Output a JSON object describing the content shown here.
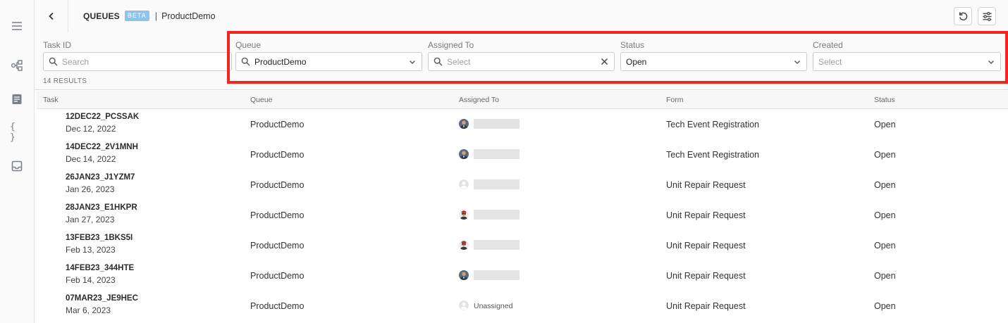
{
  "header": {
    "title": "QUEUES",
    "badge": "BETA",
    "separator": "|",
    "current": "ProductDemo"
  },
  "sidebar": {
    "icons": [
      "menu-icon",
      "workflow-icon",
      "document-icon",
      "code-braces-icon",
      "inbox-icon"
    ]
  },
  "filters": {
    "task_id": {
      "label": "Task ID",
      "placeholder": "Search"
    },
    "queue": {
      "label": "Queue",
      "value": "ProductDemo"
    },
    "assigned_to": {
      "label": "Assigned To",
      "placeholder": "Select"
    },
    "status": {
      "label": "Status",
      "value": "Open"
    },
    "created": {
      "label": "Created",
      "placeholder": "Select"
    }
  },
  "results_count": "14 RESULTS",
  "table": {
    "columns": [
      "Task",
      "Queue",
      "Assigned To",
      "Form",
      "Status"
    ],
    "rows": [
      {
        "id": "12DEC22_PCSSAK",
        "date": "Dec 12, 2022",
        "queue": "ProductDemo",
        "avatar": "person-a",
        "assigned": "",
        "form": "Tech Event Registration",
        "status": "Open"
      },
      {
        "id": "14DEC22_2V1MNH",
        "date": "Dec 14, 2022",
        "queue": "ProductDemo",
        "avatar": "person-a",
        "assigned": "",
        "form": "Tech Event Registration",
        "status": "Open"
      },
      {
        "id": "26JAN23_J1YZM7",
        "date": "Jan 26, 2023",
        "queue": "ProductDemo",
        "avatar": "default",
        "assigned": "",
        "form": "Unit Repair Request",
        "status": "Open"
      },
      {
        "id": "28JAN23_E1HKPR",
        "date": "Jan 27, 2023",
        "queue": "ProductDemo",
        "avatar": "person-b",
        "assigned": "",
        "form": "Unit Repair Request",
        "status": "Open"
      },
      {
        "id": "13FEB23_1BKS5I",
        "date": "Feb 13, 2023",
        "queue": "ProductDemo",
        "avatar": "person-b",
        "assigned": "",
        "form": "Unit Repair Request",
        "status": "Open"
      },
      {
        "id": "14FEB23_344HTE",
        "date": "Feb 14, 2023",
        "queue": "ProductDemo",
        "avatar": "person-a",
        "assigned": "",
        "form": "Unit Repair Request",
        "status": "Open"
      },
      {
        "id": "07MAR23_JE9HEC",
        "date": "Mar 6, 2023",
        "queue": "ProductDemo",
        "avatar": "default",
        "assigned": "Unassigned",
        "form": "Unit Repair Request",
        "status": "Open"
      }
    ]
  },
  "colors": {
    "highlight": "#f2261d",
    "beta_badge": "#8ec3ec"
  }
}
